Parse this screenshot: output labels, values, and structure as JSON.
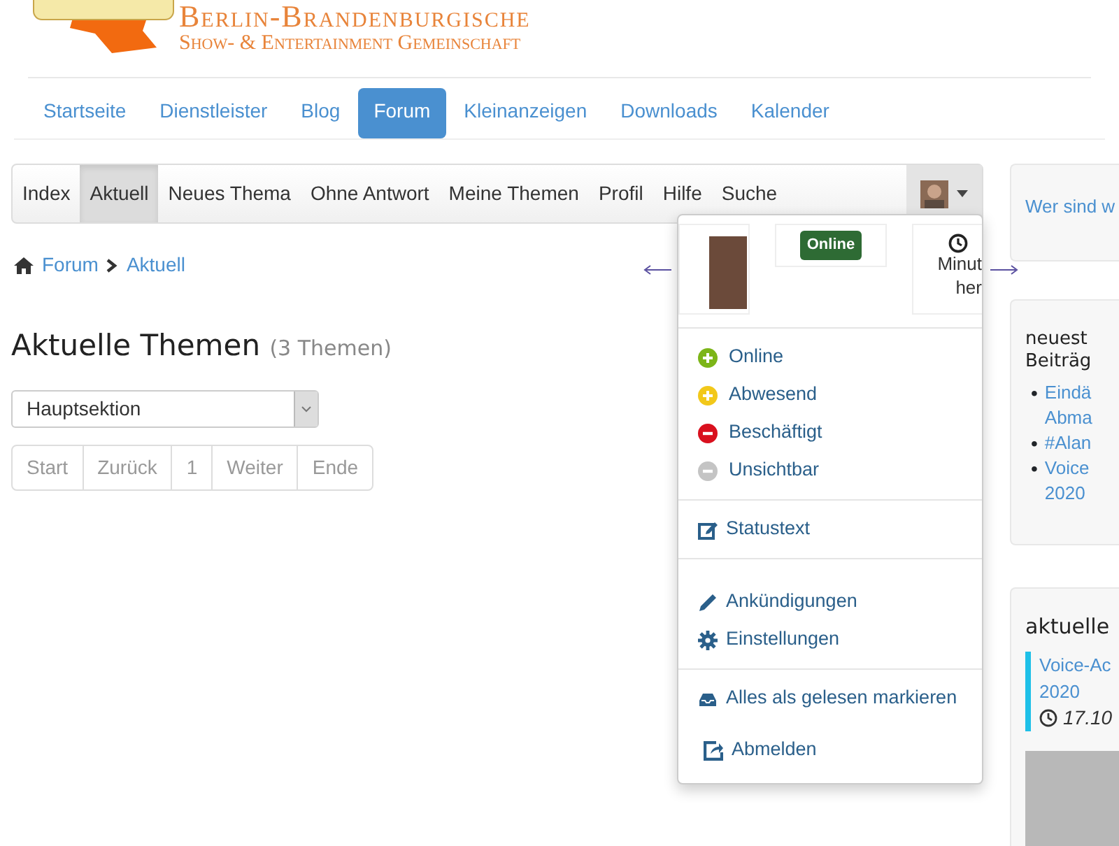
{
  "header": {
    "title": "Berlin-Brandenburgische",
    "subtitle": "Show- & Entertainment Gemeinschaft"
  },
  "main_nav": [
    {
      "label": "Startseite",
      "selected": false
    },
    {
      "label": "Dienstleister",
      "selected": false
    },
    {
      "label": "Blog",
      "selected": false
    },
    {
      "label": "Forum",
      "selected": true
    },
    {
      "label": "Kleinanzeigen",
      "selected": false
    },
    {
      "label": "Downloads",
      "selected": false
    },
    {
      "label": "Kalender",
      "selected": false
    }
  ],
  "forum_nav": [
    {
      "label": "Index",
      "selected": false
    },
    {
      "label": "Aktuell",
      "selected": true
    },
    {
      "label": "Neues Thema",
      "selected": false
    },
    {
      "label": "Ohne Antwort",
      "selected": false
    },
    {
      "label": "Meine Themen",
      "selected": false
    },
    {
      "label": "Profil",
      "selected": false
    },
    {
      "label": "Hilfe",
      "selected": false
    },
    {
      "label": "Suche",
      "selected": false
    }
  ],
  "breadcrumb": [
    "Forum",
    "Aktuell"
  ],
  "heading": {
    "title": "Aktuelle Themen",
    "count": "(3 Themen)"
  },
  "section_select": {
    "value": "Hauptsektion"
  },
  "pagination": [
    "Start",
    "Zurück",
    "1",
    "Weiter",
    "Ende"
  ],
  "user_menu": {
    "expanded": true,
    "status_badge": "Online",
    "time_lines": [
      "Minut",
      "her"
    ],
    "statuses": [
      {
        "label": "Online",
        "color": "#7cb518"
      },
      {
        "label": "Abwesend",
        "color": "#f2c81a"
      },
      {
        "label": "Beschäftigt",
        "color": "#d9101e"
      },
      {
        "label": "Unsichtbar",
        "color": "#c4c4c4"
      }
    ],
    "links": [
      {
        "label": "Statustext"
      },
      {
        "label": "Ankündigungen"
      },
      {
        "label": "Einstellungen"
      },
      {
        "label": "Alles als gelesen markieren"
      },
      {
        "label": "Abmelden"
      }
    ]
  },
  "sidebar": {
    "about_link": "Wer sind w",
    "latest": {
      "title_lines": [
        "neuest",
        "Beiträg"
      ],
      "items": [
        {
          "marker": "•",
          "lines": [
            "Eindä",
            "Abma"
          ]
        },
        {
          "marker": "•",
          "lines": [
            "#Alan"
          ]
        },
        {
          "marker": "•",
          "lines": [
            "Voice",
            "2020"
          ]
        }
      ]
    },
    "events": {
      "title": "aktuelle",
      "event_lines": [
        "Voice-Ac",
        "2020"
      ],
      "date": "17.10"
    }
  }
}
